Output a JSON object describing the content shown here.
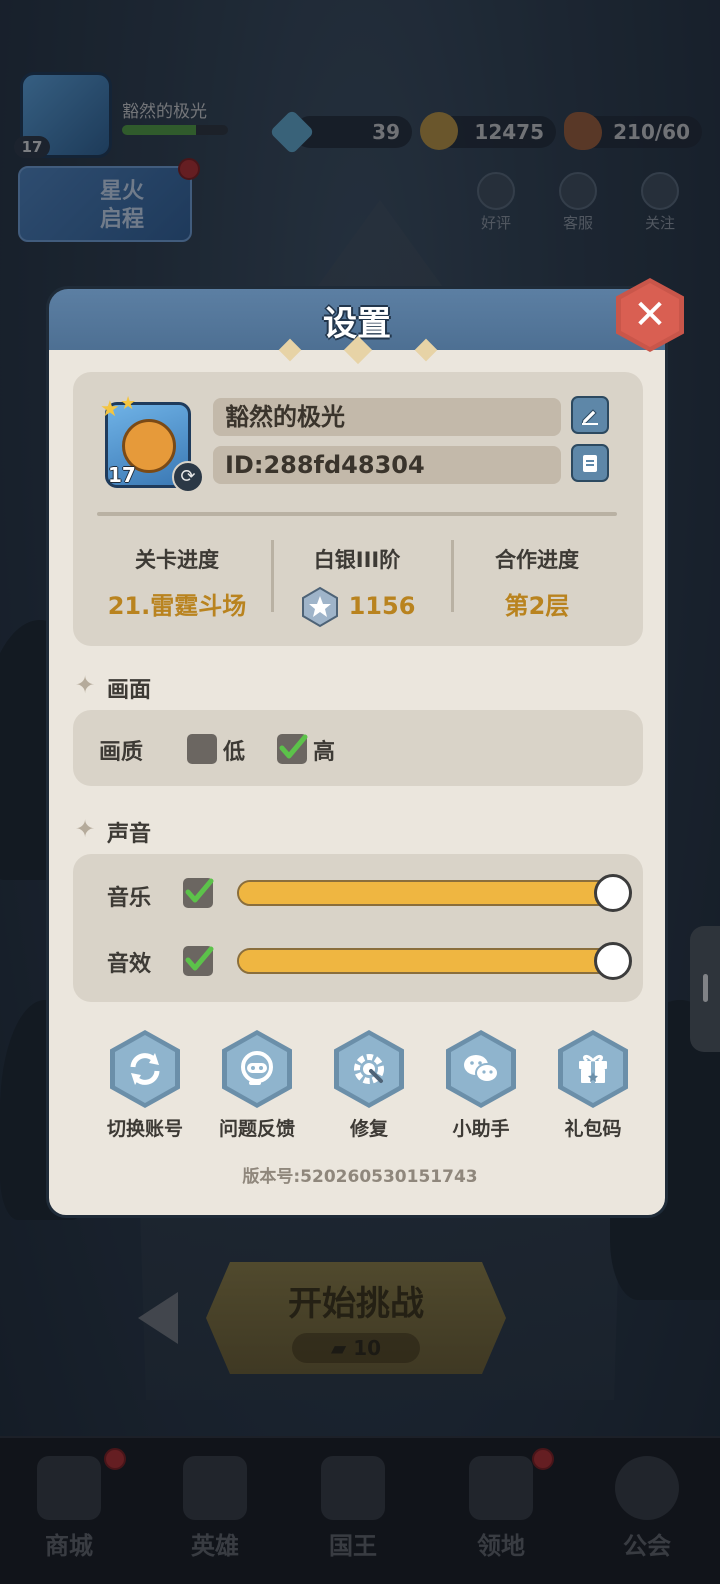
{
  "hud": {
    "player_name": "豁然的极光",
    "level": "17",
    "exp_fraction": 0.7,
    "gems": "39",
    "gold": "12475",
    "stamina": "210/60",
    "buttons": [
      "好评",
      "客服",
      "关注"
    ],
    "event_banner": [
      "星火",
      "启程"
    ]
  },
  "dialog": {
    "title": "设置",
    "close_glyph": "✕",
    "profile": {
      "name": "豁然的极光",
      "id": "ID:288fd48304",
      "level": "17"
    },
    "stats": [
      {
        "label": "关卡进度",
        "value": "21.雷霆斗场"
      },
      {
        "label": "白银III阶",
        "value": "1156"
      },
      {
        "label": "合作进度",
        "value": "第2层"
      }
    ],
    "display": {
      "section_title": "画面",
      "quality_label": "画质",
      "options": [
        {
          "label": "低",
          "checked": false
        },
        {
          "label": "高",
          "checked": true
        }
      ]
    },
    "sound": {
      "section_title": "声音",
      "rows": [
        {
          "label": "音乐",
          "enabled": true,
          "level": 1.0
        },
        {
          "label": "音效",
          "enabled": true,
          "level": 1.0
        }
      ]
    },
    "actions": [
      {
        "label": "切换账号",
        "icon": "switch-account-icon"
      },
      {
        "label": "问题反馈",
        "icon": "feedback-icon"
      },
      {
        "label": "修复",
        "icon": "repair-gear-icon"
      },
      {
        "label": "小助手",
        "icon": "wechat-assistant-icon"
      },
      {
        "label": "礼包码",
        "icon": "gift-code-icon"
      }
    ],
    "version": "版本号:520260530151743"
  },
  "start_button": {
    "label": "开始挑战",
    "cost": "10"
  },
  "bottom_nav": [
    "商城",
    "英雄",
    "国王",
    "领地",
    "公会"
  ],
  "colors": {
    "accent_gold": "#b9831f",
    "slider_fill": "#efb641",
    "header_blue": "#486a8d",
    "close_red": "#d95f52",
    "check_green": "#5cc24a"
  }
}
